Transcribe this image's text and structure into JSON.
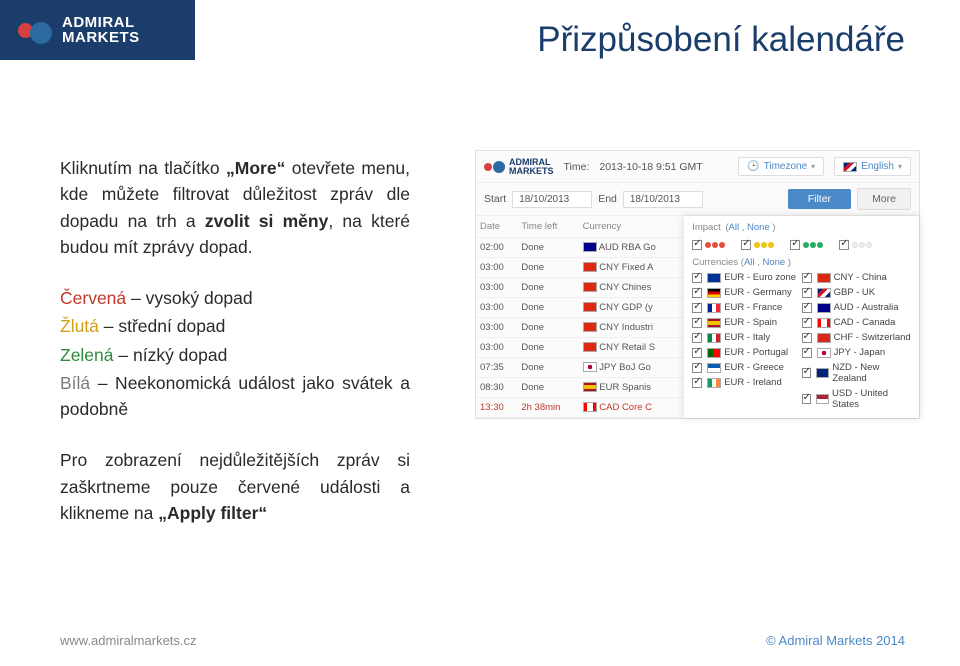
{
  "brand": {
    "line1": "ADMIRAL",
    "line2": "MARKETS"
  },
  "title": "Přizpůsobení kalendáře",
  "intro": {
    "p1_a": "Kliknutím na tlačítko ",
    "p1_b": "„More“",
    "p1_c": " otevřete menu, kde můžete filtrovat důležitost zpráv dle dopadu na trh a ",
    "p1_d": "zvolit si měny",
    "p1_e": ", na které budou mít zprávy dopad."
  },
  "impacts": {
    "r_word": "Červená",
    "r_rest": " – vysoký dopad",
    "y_word": "Žlutá",
    "y_rest": " – střední dopad",
    "g_word": "Zelená",
    "g_rest": " – nízký dopad",
    "w_word": "Bílá",
    "w_rest": " – Neekonomická událost jako svátek a podobně"
  },
  "action": {
    "a": "Pro zobrazení nejdůležitějších zpráv si zaškrtneme pouze červené události a klikneme na ",
    "b": "„Apply filter“"
  },
  "footer": {
    "left": "www.admiralmarkets.cz",
    "right": "© Admiral Markets 2014"
  },
  "cal": {
    "time_label": "Time:",
    "time_value": "2013-10-18 9:51 GMT",
    "timezone": "Timezone",
    "english": "English",
    "start_label": "Start",
    "end_label": "End",
    "start": "18/10/2013",
    "end": "18/10/2013",
    "filter_btn": "Filter",
    "more_btn": "More",
    "th_date": "Date",
    "th_timeleft": "Time left",
    "th_currency": "Currency",
    "rows": [
      {
        "t": "02:00",
        "s": "Done",
        "c": "AUD",
        "d": "RBA Go"
      },
      {
        "t": "03:00",
        "s": "Done",
        "c": "CNY",
        "d": "Fixed A"
      },
      {
        "t": "03:00",
        "s": "Done",
        "c": "CNY",
        "d": "Chines"
      },
      {
        "t": "03:00",
        "s": "Done",
        "c": "CNY",
        "d": "GDP (y"
      },
      {
        "t": "03:00",
        "s": "Done",
        "c": "CNY",
        "d": "Industri"
      },
      {
        "t": "03:00",
        "s": "Done",
        "c": "CNY",
        "d": "Retail S"
      },
      {
        "t": "07:35",
        "s": "Done",
        "c": "JPY",
        "d": "BoJ Go"
      },
      {
        "t": "08:30",
        "s": "Done",
        "c": "EUR",
        "d": "Spanis"
      },
      {
        "t": "13:30",
        "s": "2h 38min",
        "c": "CAD",
        "d": "Core C"
      }
    ],
    "impact_label": "Impact",
    "all": "All",
    "none": "None",
    "currencies_label": "Currencies",
    "left_col": [
      {
        "c": "EUR",
        "n": "Euro zone",
        "f": "flag-eu"
      },
      {
        "c": "EUR",
        "n": "Germany",
        "f": "flag-de"
      },
      {
        "c": "EUR",
        "n": "France",
        "f": "flag-fr"
      },
      {
        "c": "EUR",
        "n": "Spain",
        "f": "flag-es"
      },
      {
        "c": "EUR",
        "n": "Italy",
        "f": "flag-it"
      },
      {
        "c": "EUR",
        "n": "Portugal",
        "f": "flag-pt"
      },
      {
        "c": "EUR",
        "n": "Greece",
        "f": "flag-gr"
      },
      {
        "c": "EUR",
        "n": "Ireland",
        "f": "flag-ie"
      }
    ],
    "right_col": [
      {
        "c": "CNY",
        "n": "China",
        "f": "flag-cn"
      },
      {
        "c": "GBP",
        "n": "UK",
        "f": "flag-uk"
      },
      {
        "c": "AUD",
        "n": "Australia",
        "f": "flag-au"
      },
      {
        "c": "CAD",
        "n": "Canada",
        "f": "flag-ca"
      },
      {
        "c": "CHF",
        "n": "Switzerland",
        "f": "flag-ch"
      },
      {
        "c": "JPY",
        "n": "Japan",
        "f": "flag-jp"
      },
      {
        "c": "NZD",
        "n": "New Zealand",
        "f": "flag-nz"
      },
      {
        "c": "USD",
        "n": "United States",
        "f": "flag-us"
      }
    ]
  }
}
